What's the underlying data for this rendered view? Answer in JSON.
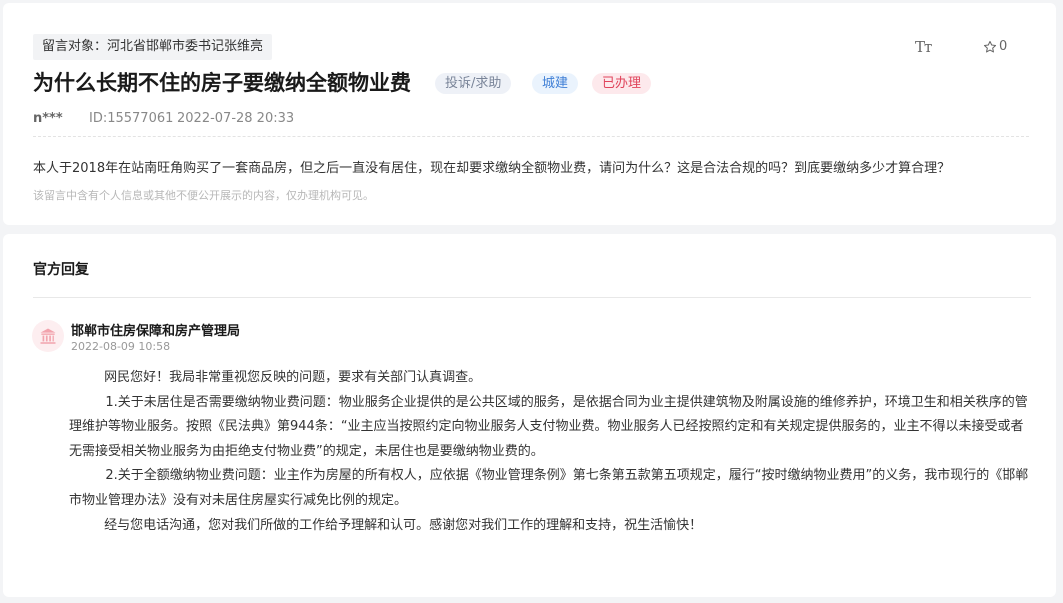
{
  "message": {
    "target": "留言对象：河北省邯郸市委书记张维亮",
    "title": "为什么长期不住的房子要缴纳全额物业费",
    "tags": {
      "type": "投诉/求助",
      "domain": "城建",
      "status": "已办理"
    },
    "tools": {
      "font_size_icon": "font-size-icon",
      "font_size_glyph": "Tт",
      "favorite_icon": "star-icon",
      "favorite_count": "0"
    },
    "author": "n***",
    "id": "ID:15577061",
    "time": "2022-07-28 20:33",
    "content": "本人于2018年在站南旺角购买了一套商品房，但之后一直没有居住，现在却要求缴纳全额物业费，请问为什么？这是合法合规的吗？到底要缴纳多少才算合理？",
    "privacy_note": "该留言中含有个人信息或其他不便公开展示的内容，仅办理机构可见。"
  },
  "reply": {
    "heading": "官方回复",
    "org_icon": "government-building-icon",
    "org_name": "邯郸市住房保障和房产管理局",
    "date": "2022-08-09 10:58",
    "paragraphs": [
      "网民您好！我局非常重视您反映的问题，要求有关部门认真调查。",
      "1.关于未居住是否需要缴纳物业费问题：物业服务企业提供的是公共区域的服务，是依据合同为业主提供建筑物及附属设施的维修养护，环境卫生和相关秩序的管理维护等物业服务。按照《民法典》第944条：“业主应当按照约定向物业服务人支付物业费。物业服务人已经按照约定和有关规定提供服务的，业主不得以未接受或者无需接受相关物业服务为由拒绝支付物业费”的规定，未居住也是要缴纳物业费的。",
      "2.关于全额缴纳物业费问题：业主作为房屋的所有权人，应依据《物业管理条例》第七条第五款第五项规定，履行“按时缴纳物业费用”的义务，我市现行的《邯郸市物业管理办法》没有对未居住房屋实行减免比例的规定。",
      "经与您电话沟通，您对我们所做的工作给予理解和认可。感谢您对我们工作的理解和支持，祝生活愉快！"
    ]
  },
  "colors": {
    "tag_status": "#e0455c",
    "tag_domain": "#3f7fd6",
    "tag_type": "#7a8599"
  }
}
